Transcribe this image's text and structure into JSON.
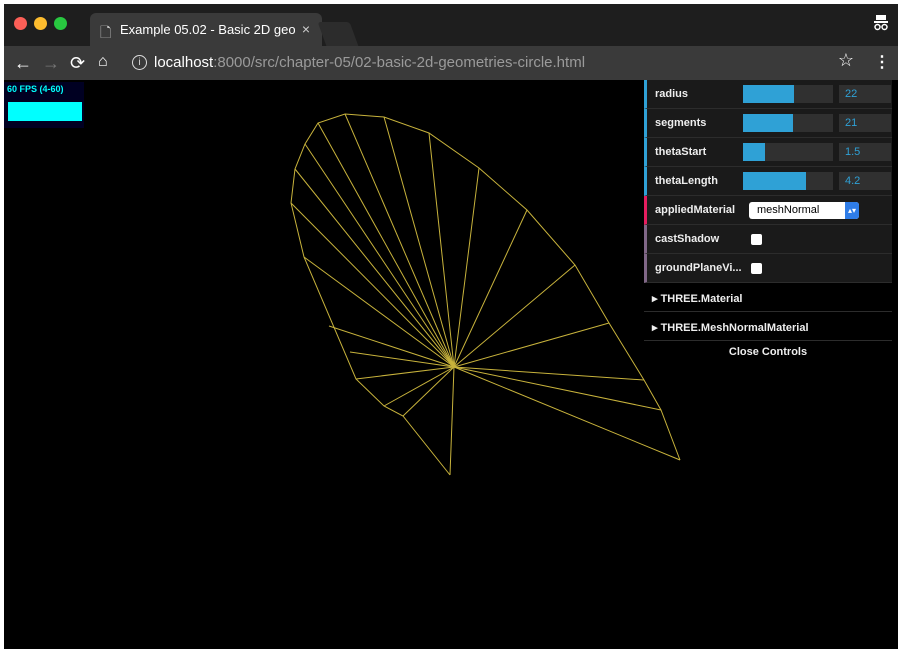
{
  "browser": {
    "tab_title": "Example 05.02 - Basic 2D geometries - Circle",
    "tab_close": "×",
    "url_host": "localhost",
    "url_path": ":8000/src/chapter-05/02-basic-2d-geometries-circle.html"
  },
  "stats": {
    "fps_label": "60 FPS (4-60)"
  },
  "controls": {
    "sliders": [
      {
        "label": "radius",
        "value": "22",
        "fill": 0.57,
        "color": "#2fa1d6"
      },
      {
        "label": "segments",
        "value": "21",
        "fill": 0.55,
        "color": "#2fa1d6"
      },
      {
        "label": "thetaStart",
        "value": "1.5",
        "fill": 0.24,
        "color": "#2fa1d6"
      },
      {
        "label": "thetaLength",
        "value": "4.2",
        "fill": 0.7,
        "color": "#2fa1d6"
      }
    ],
    "applied_material": {
      "label": "appliedMaterial",
      "value": "meshNormal",
      "accent": "#e61d5f"
    },
    "cast_shadow": {
      "label": "castShadow",
      "checked": false
    },
    "ground_plane": {
      "label": "groundPlaneVi...",
      "checked": false
    },
    "folders": [
      {
        "label": "THREE.Material"
      },
      {
        "label": "THREE.MeshNormalMaterial"
      }
    ],
    "close_label": "Close Controls"
  }
}
